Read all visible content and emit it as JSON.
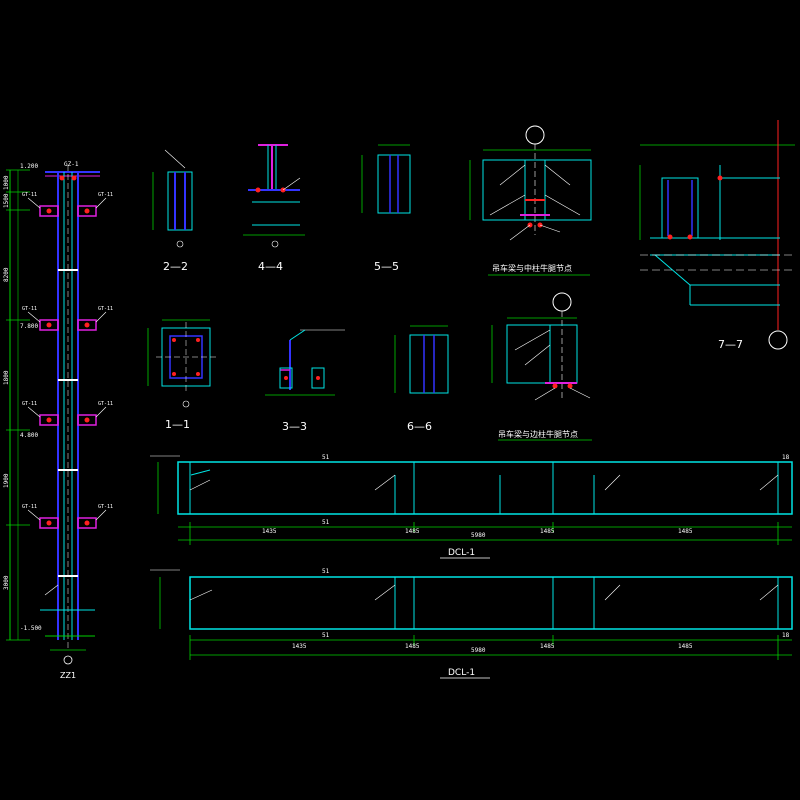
{
  "colors": {
    "background": "#000000",
    "cyan": "#00e5e5",
    "green": "#00d000",
    "white": "#ffffff",
    "red": "#ff2020",
    "blue": "#3333ff",
    "magenta": "#e020e0",
    "yellow": "#ffff00"
  },
  "column": {
    "title": "ZZ1",
    "top_tag": "GZ-1",
    "elevations": [
      "1.200",
      "7.800",
      "4.800",
      "-1.500"
    ],
    "left_dims": [
      "1000",
      "1500",
      "8200",
      "1800",
      "1900",
      "3000"
    ],
    "bracket_tags": [
      "GT-11",
      "GT-11",
      "GT-11",
      "GT-11",
      "GT-11",
      "GT-11",
      "GT-11",
      "GT-11"
    ]
  },
  "sections": {
    "s22": "2—2",
    "s44": "4—4",
    "s55": "5—5",
    "s11": "1—1",
    "s33": "3—3",
    "s66": "6—6",
    "s77": "7—7"
  },
  "details": {
    "detail_a_title": "吊车梁与中柱牛腿节点",
    "detail_b_title": "吊车梁与边柱牛腿节点"
  },
  "beams": [
    {
      "title": "DCL-1",
      "total": "5980",
      "segs": [
        "1435",
        "1485",
        "1485",
        "1485"
      ],
      "top_tag": "51",
      "bot_tag": "51",
      "end_tag": "18"
    },
    {
      "title": "DCL-1",
      "total": "5980",
      "segs": [
        "1435",
        "1485",
        "1485",
        "1485"
      ],
      "top_tag": "51",
      "bot_tag": "51",
      "end_tag": "18"
    }
  ]
}
